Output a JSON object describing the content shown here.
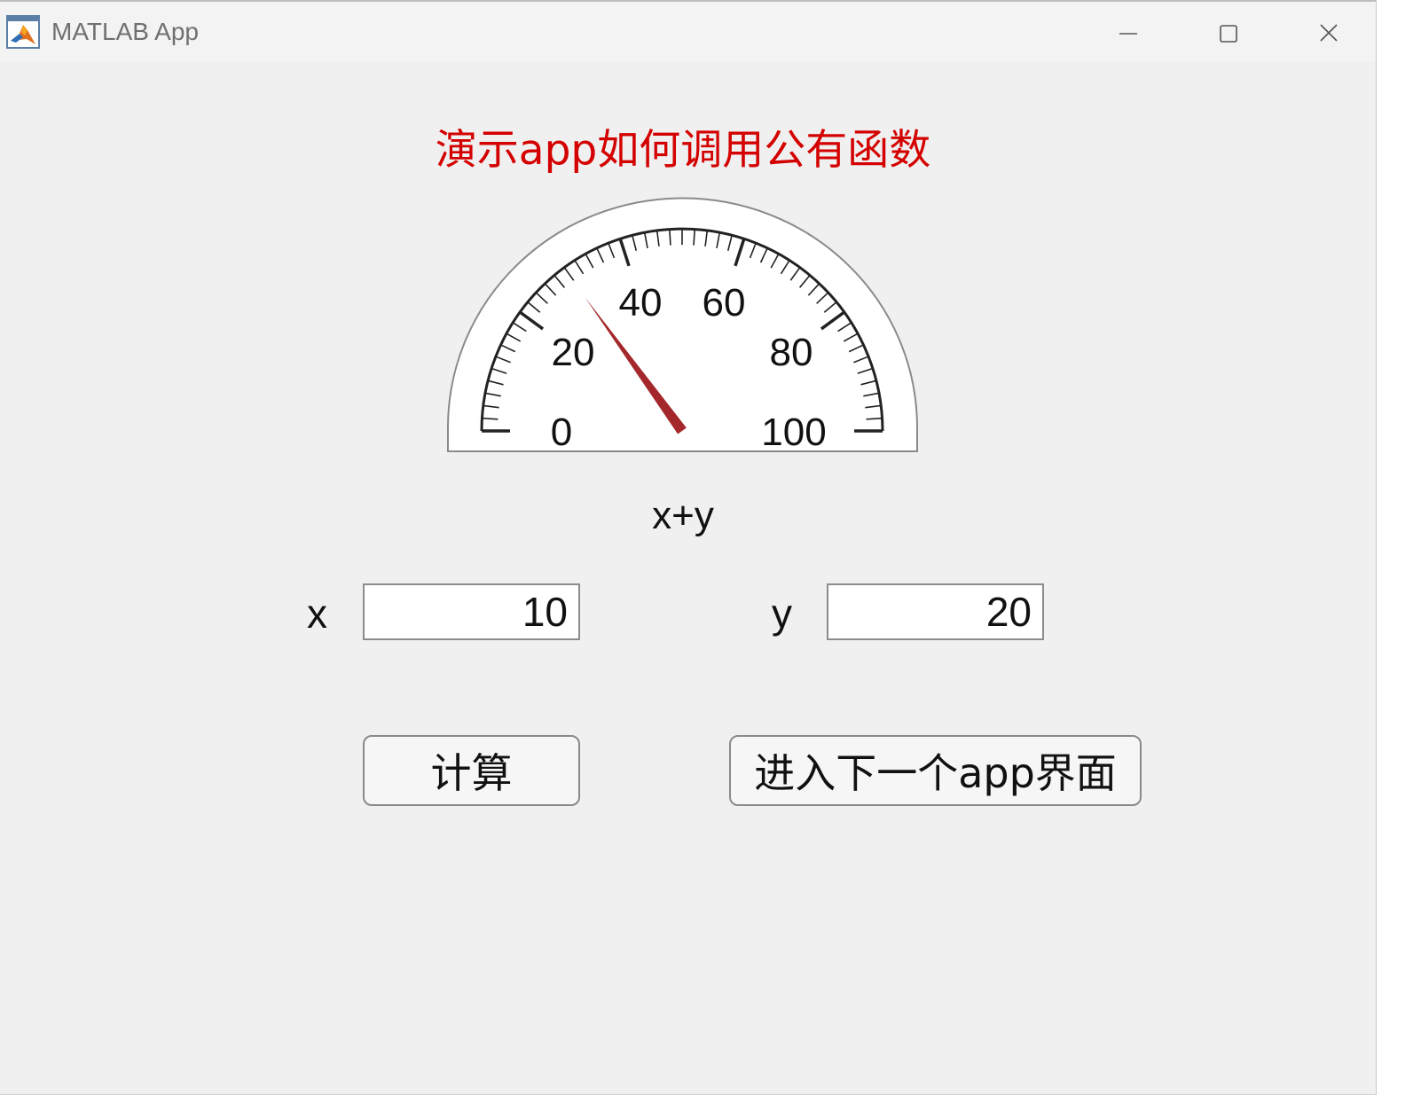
{
  "window": {
    "title": "MATLAB App",
    "icon": "matlab-logo-icon",
    "controls": [
      "minimize-icon",
      "maximize-icon",
      "close-icon"
    ]
  },
  "heading": "演示app如何调用公有函数",
  "colors": {
    "heading": "#d40000",
    "needle": "#a4282b",
    "background": "#f0f0f0"
  },
  "gauge": {
    "type": "semicircular-gauge",
    "label": "x+y",
    "min": 0,
    "max": 100,
    "value": 30,
    "major_ticks": [
      "0",
      "20",
      "40",
      "60",
      "80",
      "100"
    ]
  },
  "inputs": {
    "x": {
      "label": "x",
      "value": "10"
    },
    "y": {
      "label": "y",
      "value": "20"
    }
  },
  "buttons": {
    "calculate": "计算",
    "next": "进入下一个app界面"
  }
}
